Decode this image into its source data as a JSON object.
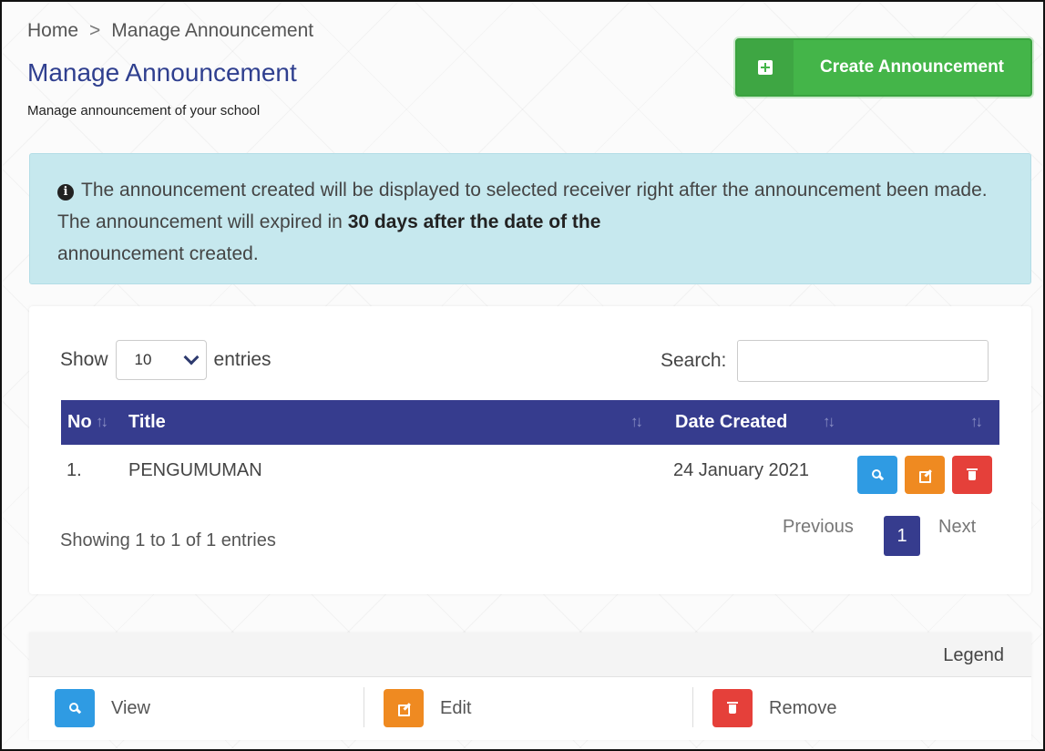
{
  "breadcrumb": {
    "home": "Home",
    "separator": ">",
    "current": "Manage Announcement"
  },
  "header": {
    "title": "Manage Announcement",
    "subtitle": "Manage announcement of your school",
    "create_button": "Create Announcement",
    "create_icon": "plus-square-icon"
  },
  "alert": {
    "icon": "info-circle-icon",
    "text_part1": "The announcement created will be displayed to selected receiver right after the announcement been made. The announcement will expired in ",
    "text_strong": "30 days after the date of the",
    "text_part2": "announcement created."
  },
  "table_controls": {
    "show_label": "Show",
    "entries_value": "10",
    "entries_label": "entries",
    "search_label": "Search:",
    "search_value": ""
  },
  "table": {
    "columns": [
      "No",
      "Title",
      "Date Created"
    ],
    "rows": [
      {
        "no": "1.",
        "title": "PENGUMUMAN",
        "date": "24 January 2021"
      }
    ]
  },
  "pagination": {
    "info": "Showing 1 to 1 of 1 entries",
    "previous": "Previous",
    "current_page": "1",
    "next": "Next"
  },
  "legend": {
    "title": "Legend",
    "items": [
      {
        "label": "View",
        "icon": "search-icon"
      },
      {
        "label": "Edit",
        "icon": "edit-icon"
      },
      {
        "label": "Remove",
        "icon": "trash-icon"
      }
    ]
  },
  "colors": {
    "primary": "#363c8e",
    "success": "#44b549",
    "info_bg": "#c6e8ee",
    "view": "#2f9be3",
    "edit": "#ef8a21",
    "remove": "#e5403a"
  }
}
